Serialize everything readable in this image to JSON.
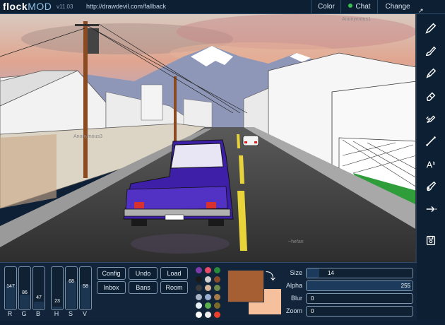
{
  "app": {
    "logo_main": "flock",
    "logo_mod": "MOD",
    "version": "v11.03",
    "url": "http://drawdevil.com/fallback"
  },
  "topbar": {
    "color_label": "Color",
    "chat_label": "Chat",
    "change_label": "Change"
  },
  "canvas": {
    "users": [
      "Anonymous1",
      "Anonymous3",
      "~hefan"
    ]
  },
  "tools": [
    {
      "name": "pen",
      "icon": "pen-icon"
    },
    {
      "name": "brush",
      "icon": "brush-icon"
    },
    {
      "name": "pencil",
      "icon": "pencil-icon"
    },
    {
      "name": "eraser",
      "icon": "eraser-icon"
    },
    {
      "name": "smudge",
      "icon": "smudge-icon"
    },
    {
      "name": "line",
      "icon": "line-icon"
    },
    {
      "name": "text",
      "icon": "text-icon"
    },
    {
      "name": "fill",
      "icon": "fill-icon"
    },
    {
      "name": "move",
      "icon": "arrow-right-icon"
    },
    {
      "name": "save",
      "icon": "save-icon"
    }
  ],
  "sliders": [
    {
      "label": "R",
      "value": "147",
      "level": 0.58
    },
    {
      "label": "G",
      "value": "86",
      "level": 0.34
    },
    {
      "label": "B",
      "value": "47",
      "level": 0.18
    },
    {
      "label": "H",
      "value": "23",
      "level": 0.06
    },
    {
      "label": "S",
      "value": "68",
      "level": 0.68
    },
    {
      "label": "V",
      "value": "58",
      "level": 0.58
    }
  ],
  "buttons": {
    "config": "Config",
    "undo": "Undo",
    "load": "Load",
    "inbox": "Inbox",
    "bans": "Bans",
    "room": "Room"
  },
  "palette": [
    "#7b3aa8",
    "#e74b6a",
    "#2a8a3a",
    "#1a1a1a",
    "#d0d0d0",
    "#8a4b2a",
    "#3a3a3a",
    "#d9b8a0",
    "#6f8a4a",
    "#aab6c8",
    "#9ab0d0",
    "#a67a4a",
    "#e6f0f6",
    "#5ab04a",
    "#7a6a2a",
    "#ffffff",
    "#f0f0f0",
    "#e8402a"
  ],
  "colors": {
    "primary": "#a65f32",
    "secondary": "#f7c09c"
  },
  "properties": {
    "size_label": "Size",
    "size_value": "14",
    "size_level": 0.12,
    "alpha_label": "Alpha",
    "alpha_value": "255",
    "alpha_level": 1.0,
    "blur_label": "Blur",
    "blur_value": "0",
    "zoom_label": "Zoom",
    "zoom_value": "0"
  }
}
